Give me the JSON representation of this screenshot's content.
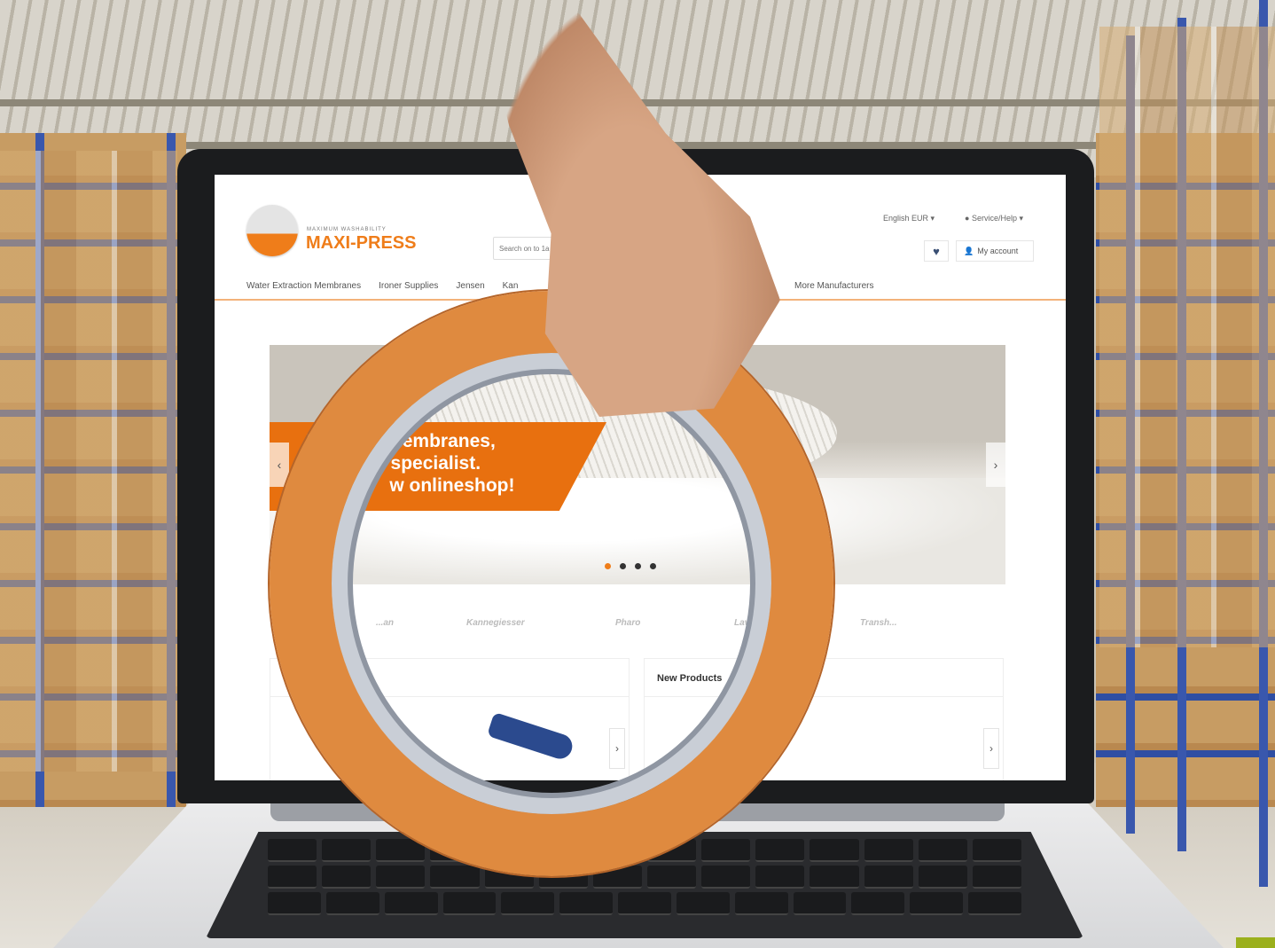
{
  "site": {
    "logo": {
      "tagline": "MAXIMUM WASHABILITY",
      "name": "MAXI-PRESS"
    },
    "search_placeholder": "Search on to 1a",
    "top_links": {
      "language": "English EUR",
      "service": "Service/Help"
    },
    "account_label": "My account",
    "wishlist_icon": "heart-icon",
    "account_icon": "user-icon",
    "nav": {
      "items": [
        "Water Extraction Membranes",
        "Ironer Supplies",
        "Jensen",
        "Kan"
      ],
      "more": "More Manufacturers"
    },
    "slider": {
      "line1": "Wa          membranes,",
      "line2": "d              specialist.",
      "line3": "                w onlineshop!",
      "prev_label": "‹",
      "next_label": "›",
      "slide_count": 4,
      "active_slide": 1
    },
    "brands": [
      "...an",
      "Kannegiesser",
      "Pharo",
      "Lavatec",
      "Transh..."
    ],
    "boxes": {
      "left_title": "",
      "right_title": "New Products",
      "arrow_label": "›"
    }
  },
  "colors": {
    "accent": "#ef7d1a",
    "nav_text": "#555555",
    "product_blue": "#2b4a8e"
  }
}
